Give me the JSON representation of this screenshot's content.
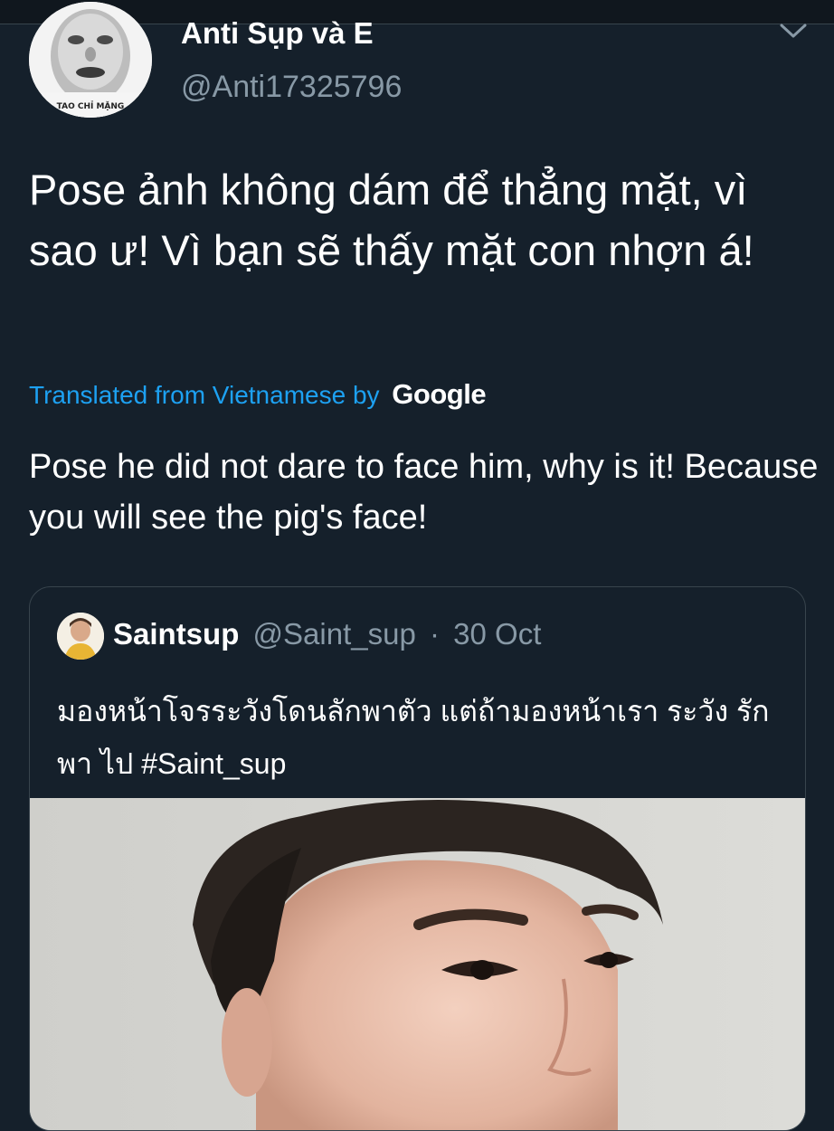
{
  "author": {
    "name": "Anti Sụp và E",
    "handle": "@Anti17325796",
    "avatar_caption": "TAO CHỈ MẶNG"
  },
  "tweet": {
    "text": "Pose ảnh không dám để thẳng mặt, vì sao ư! Vì bạn sẽ thấy mặt con nhợn á!"
  },
  "translation": {
    "label": "Translated from Vietnamese by",
    "provider": "Google",
    "text": "Pose he did not dare to face him, why is it! Because you will see the pig's face!"
  },
  "quoted_tweet": {
    "name": "Saintsup",
    "handle": "@Saint_sup",
    "separator": "·",
    "date": "30 Oct",
    "text": "มองหน้าโจรระวังโดนลักพาตัว แต่ถ้ามองหน้าเรา ระวัง รักพา ไป #Saint_sup"
  },
  "icons": {
    "menu": "chevron-down-icon"
  },
  "colors": {
    "background": "#15202b",
    "accent": "#1da1f2",
    "secondary_text": "#8899a6",
    "border": "#38444d"
  }
}
